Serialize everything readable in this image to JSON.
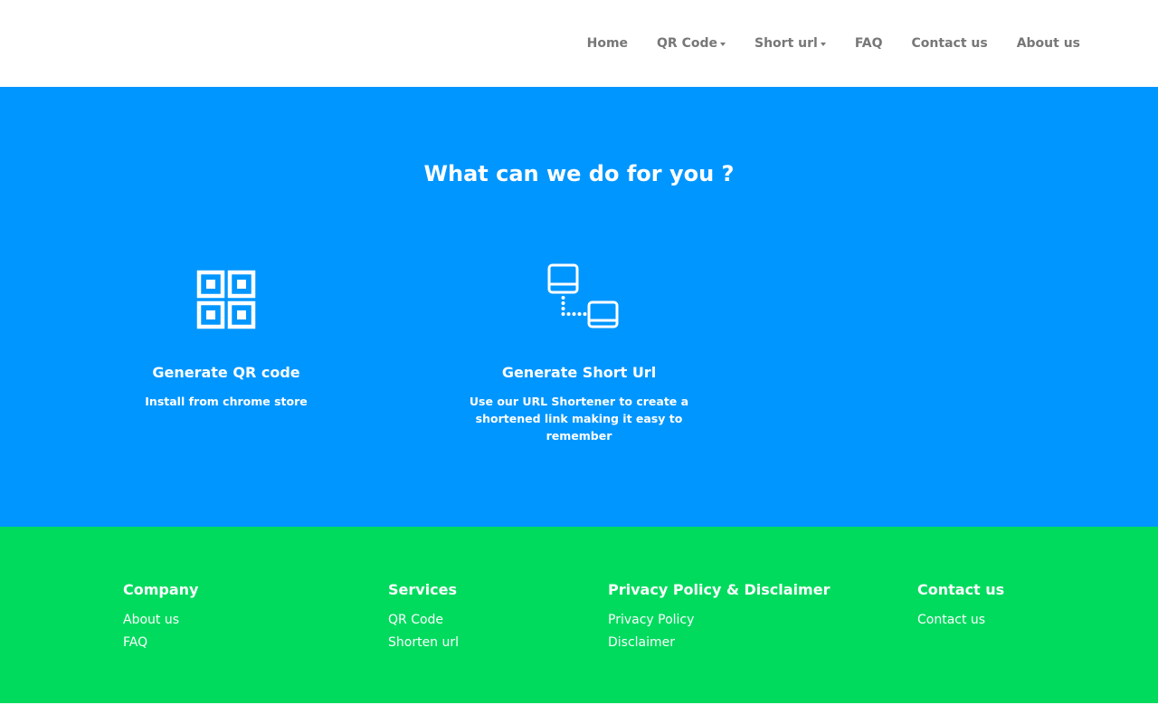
{
  "header": {
    "nav": [
      {
        "label": "Home"
      },
      {
        "label": "QR Code",
        "has_dropdown": true
      },
      {
        "label": "Short url",
        "has_dropdown": true
      },
      {
        "label": "FAQ"
      },
      {
        "label": "Contact us"
      },
      {
        "label": "About us"
      }
    ]
  },
  "hero": {
    "title": "What can we do for you ?",
    "features": [
      {
        "icon": "qr-code-icon",
        "title": "Generate QR code",
        "description": "Install from chrome store"
      },
      {
        "icon": "link-devices-icon",
        "title": "Generate Short Url",
        "description": "Use our URL Shortener to create a shortened link making it easy to remember"
      }
    ]
  },
  "footer": {
    "columns": [
      {
        "title": "Company",
        "links": [
          "About us",
          "FAQ"
        ]
      },
      {
        "title": "Services",
        "links": [
          "QR Code",
          "Shorten url"
        ]
      },
      {
        "title": "Privacy Policy & Disclaimer",
        "links": [
          "Privacy Policy",
          "Disclaimer"
        ]
      },
      {
        "title": "Contact us",
        "links": [
          "Contact us"
        ]
      }
    ]
  },
  "colors": {
    "hero_bg": "#0096FF",
    "footer_bg": "#00DB5E",
    "nav_text": "#777777",
    "page_bg": "#FFFFFF"
  }
}
